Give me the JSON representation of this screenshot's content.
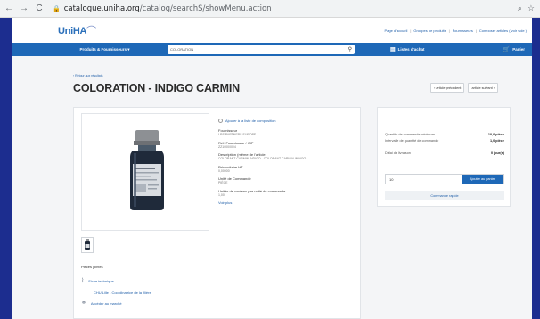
{
  "browser": {
    "back": "←",
    "forward": "→",
    "reload": "C",
    "url_host": "catalogue.uniha.org",
    "url_path": "/catalog/searchS/showMenu.action"
  },
  "site": {
    "logo": "UniHA",
    "top_links": [
      "Page d'accueil",
      "Groupes de produits",
      "Fournisseurs",
      "Composer articles ( voir vide )"
    ],
    "menu": {
      "products_label": "Produits & Fournisseurs ▾",
      "search_value": "COLORATION",
      "list_label": "Listes d'achat",
      "cart_label": "Panier"
    }
  },
  "page": {
    "back_label": "‹ Retour aux résultats",
    "title": "COLORATION - INDIGO CARMIN",
    "prev_label": "‹  article précédent",
    "next_label": "article suivant  ›"
  },
  "product": {
    "composition_link": "Ajouter à la liste de composition",
    "fields": [
      {
        "label": "Fournisseur",
        "value": "LRS PARTNERS EUROPE"
      },
      {
        "label": "Réf. Fournisseur / CIP",
        "value": "ZZ1000/00/4"
      },
      {
        "label": "Description (même de l'article",
        "value": "COLORANT CARMIN INDIGO - COLORANT CARMIN INDIGO"
      },
      {
        "label": "Prix unitaire HT",
        "value": "0,00000"
      },
      {
        "label": "Unité de Commande",
        "value": "pièce"
      },
      {
        "label": "Unités de contenu par unité de commande",
        "value": "1,00"
      }
    ],
    "voir_plus": "Voir plus",
    "attachments_title": "Pièces jointes",
    "fiche_technique": "Fiche technique",
    "chu_label": "CHU Lille - Coordinatrice de la filière",
    "marche_label": "Accéder au marché"
  },
  "order": {
    "rows": [
      {
        "label": "Quantité de commande minimum",
        "value": "10,0 pièce"
      },
      {
        "label": "Intervalle de quantité de commande",
        "value": "1,0 pièce"
      },
      {
        "label": "Délai de livraison",
        "value": "0 jour(s)"
      }
    ],
    "quantity": "10",
    "add_to_cart": "Ajouter au panier",
    "quick_order": "Commande rapide"
  },
  "colors": {
    "frame": "#1c2d8f",
    "primary": "#1e68b7",
    "link": "#1f5ea8"
  },
  "icons": [
    "search-icon",
    "list-icon",
    "cart-icon",
    "paperclip-icon",
    "link-icon",
    "star-icon",
    "zoom-icon",
    "lock-icon"
  ]
}
